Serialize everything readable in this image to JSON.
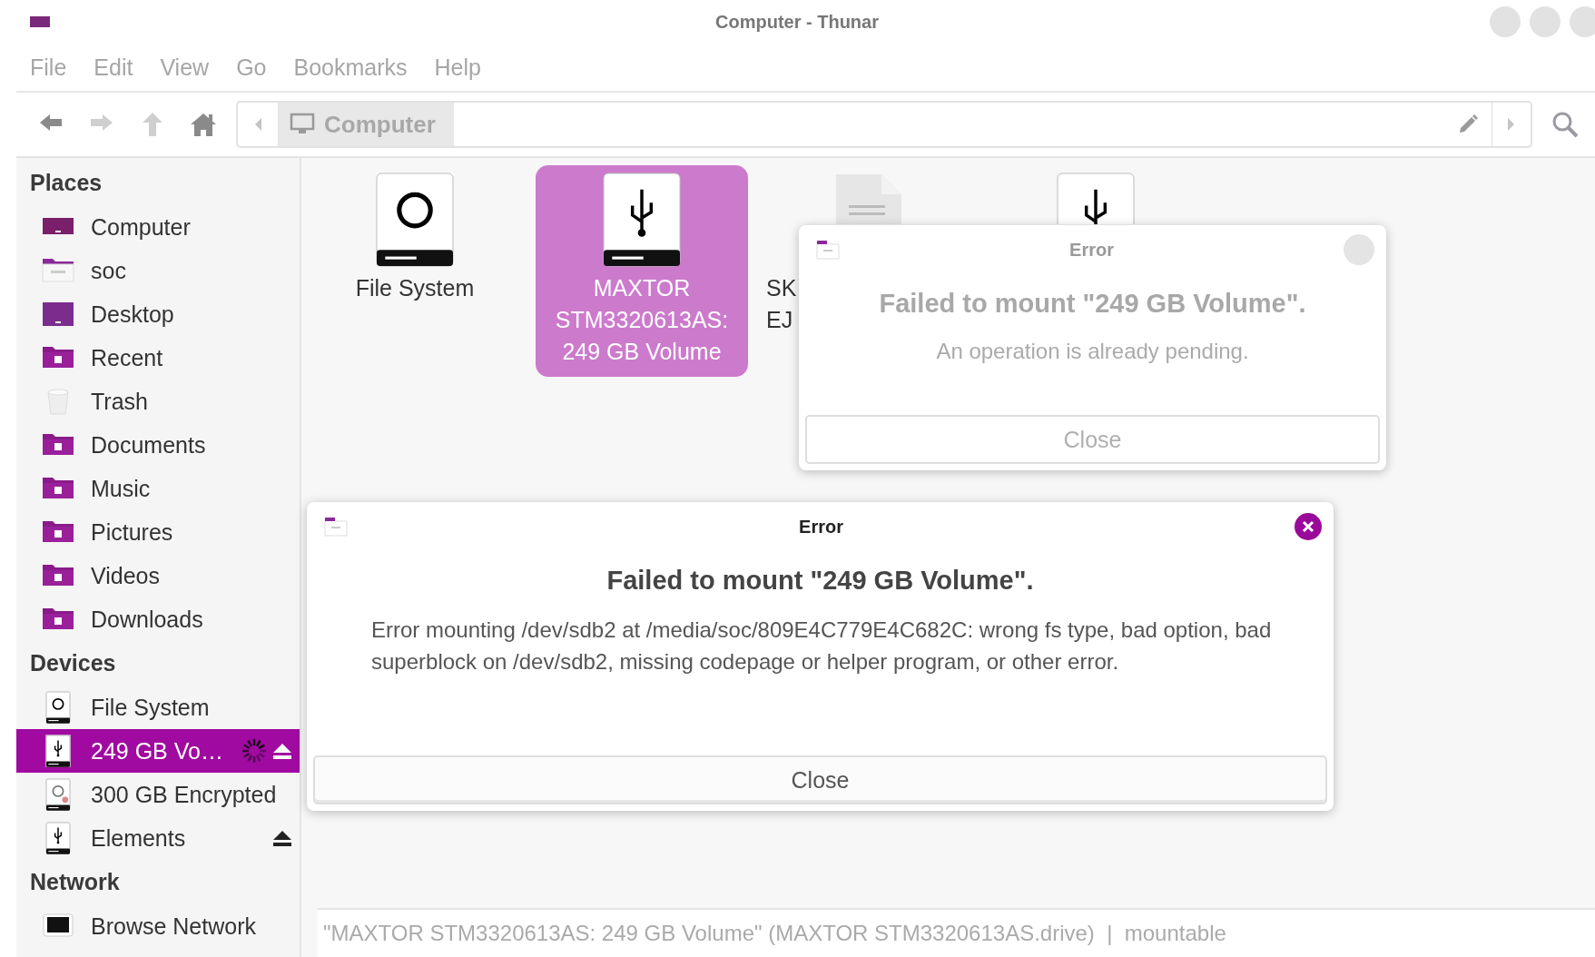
{
  "window": {
    "title": "Computer - Thunar"
  },
  "menu": [
    "File",
    "Edit",
    "View",
    "Go",
    "Bookmarks",
    "Help"
  ],
  "toolbar": [
    {
      "kind": "back",
      "disabled": false
    },
    {
      "kind": "forward",
      "disabled": true
    },
    {
      "kind": "up",
      "disabled": true
    },
    {
      "kind": "home",
      "disabled": false
    }
  ],
  "path_bar": {
    "segments": [
      {
        "label": "Computer",
        "selected": true
      }
    ]
  },
  "sidebar": {
    "sections": [
      {
        "title": "Places",
        "items": [
          {
            "label": "Computer",
            "kind": "computer",
            "selected": false
          },
          {
            "label": "soc",
            "kind": "home",
            "selected": false
          },
          {
            "label": "Desktop",
            "kind": "desktop",
            "selected": false
          },
          {
            "label": "Recent",
            "kind": "folder",
            "selected": false
          },
          {
            "label": "Trash",
            "kind": "trash",
            "selected": false
          },
          {
            "label": "Documents",
            "kind": "folder",
            "selected": false
          },
          {
            "label": "Music",
            "kind": "folder",
            "selected": false
          },
          {
            "label": "Pictures",
            "kind": "folder",
            "selected": false
          },
          {
            "label": "Videos",
            "kind": "folder",
            "selected": false
          },
          {
            "label": "Downloads",
            "kind": "folder",
            "selected": false
          }
        ]
      },
      {
        "title": "Devices",
        "items": [
          {
            "label": "File System",
            "kind": "drive",
            "selected": false,
            "busy": false,
            "ejectable": false
          },
          {
            "label": "249 GB Vo…",
            "kind": "usb",
            "selected": true,
            "busy": true,
            "ejectable": true
          },
          {
            "label": "300 GB Encrypted",
            "kind": "encrypted",
            "selected": false,
            "busy": false,
            "ejectable": false
          },
          {
            "label": "Elements",
            "kind": "usb",
            "selected": false,
            "busy": false,
            "ejectable": true
          }
        ]
      },
      {
        "title": "Network",
        "items": [
          {
            "label": "Browse Network",
            "kind": "network",
            "selected": false
          }
        ]
      }
    ]
  },
  "icons": [
    {
      "lines": [
        "File System"
      ],
      "kind": "drive",
      "selected": false
    },
    {
      "lines": [
        "MAXTOR",
        "STM3320613AS:",
        "249 GB Volume"
      ],
      "kind": "usb",
      "selected": true
    },
    {
      "lines": [
        "SK",
        "EJ"
      ],
      "kind": "document",
      "selected": false
    },
    {
      "kind": "usb",
      "selected": false
    }
  ],
  "dialogs": [
    {
      "title": "Error",
      "active": false,
      "heading": "Failed to mount \"249 GB Volume\".",
      "message": "An operation is already pending.",
      "button": "Close"
    },
    {
      "title": "Error",
      "active": true,
      "heading": "Failed to mount \"249 GB Volume\".",
      "message": "Error mounting /dev/sdb2 at /media/soc/809E4C779E4C682C: wrong fs type, bad option, bad superblock on /dev/sdb2, missing codepage or helper program, or other error.",
      "button": "Close"
    }
  ],
  "status_bar": "\"MAXTOR STM3320613AS: 249 GB Volume\" (MAXTOR STM3320613AS.drive)  |  mountable"
}
